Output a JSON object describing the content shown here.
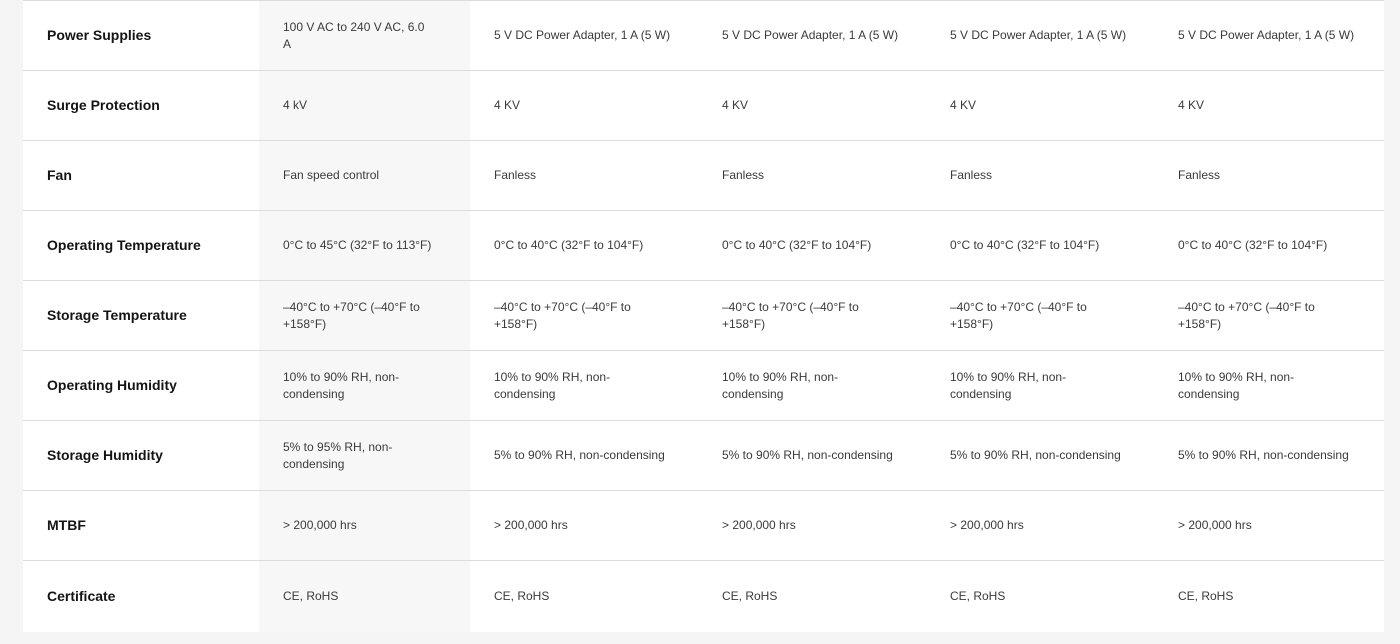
{
  "rows": [
    {
      "label": "Power Supplies",
      "values": [
        "100 V AC to 240 V AC, 6.0 A",
        "5 V DC Power Adapter, 1 A (5 W)",
        "5 V DC Power Adapter, 1 A (5 W)",
        "5 V DC Power Adapter, 1 A (5 W)",
        "5 V DC Power Adapter, 1 A (5 W)"
      ]
    },
    {
      "label": "Surge Protection",
      "values": [
        "4 kV",
        "4 KV",
        "4 KV",
        "4 KV",
        "4 KV"
      ]
    },
    {
      "label": "Fan",
      "values": [
        "Fan speed control",
        "Fanless",
        "Fanless",
        "Fanless",
        "Fanless"
      ]
    },
    {
      "label": "Operating Temperature",
      "values": [
        "0°C to 45°C (32°F to 113°F)",
        "0°C to 40°C (32°F to 104°F)",
        "0°C to 40°C (32°F to 104°F)",
        "0°C to 40°C (32°F to 104°F)",
        "0°C to 40°C (32°F to 104°F)"
      ]
    },
    {
      "label": "Storage Temperature",
      "values": [
        "–40°C to +70°C (–40°F to +158°F)",
        "–40°C to +70°C (–40°F to +158°F)",
        "–40°C to +70°C (–40°F to +158°F)",
        "–40°C to +70°C (–40°F to +158°F)",
        "–40°C to +70°C (–40°F to +158°F)"
      ]
    },
    {
      "label": "Operating Humidity",
      "values": [
        "10% to 90% RH, non-condensing",
        "10% to 90% RH, non-condensing",
        "10% to 90% RH, non-condensing",
        "10% to 90% RH, non-condensing",
        "10% to 90% RH, non-condensing"
      ]
    },
    {
      "label": "Storage Humidity",
      "values": [
        "5% to 95% RH, non-condensing",
        "5% to 90% RH, non-condensing",
        "5% to 90% RH, non-condensing",
        "5% to 90% RH, non-condensing",
        "5% to 90% RH, non-condensing"
      ]
    },
    {
      "label": "MTBF",
      "values": [
        "> 200,000 hrs",
        "> 200,000 hrs",
        "> 200,000 hrs",
        "> 200,000 hrs",
        "> 200,000 hrs"
      ]
    },
    {
      "label": "Certificate",
      "values": [
        "CE, RoHS",
        "CE, RoHS",
        "CE, RoHS",
        "CE, RoHS",
        "CE, RoHS"
      ]
    }
  ],
  "colors": {
    "page_background": "#f5f5f5",
    "panel_background": "#ffffff",
    "highlight_column": "#f7f7f8",
    "divider": "#dcdcdc",
    "label_text": "#141414",
    "value_text": "#3a3a3a"
  }
}
